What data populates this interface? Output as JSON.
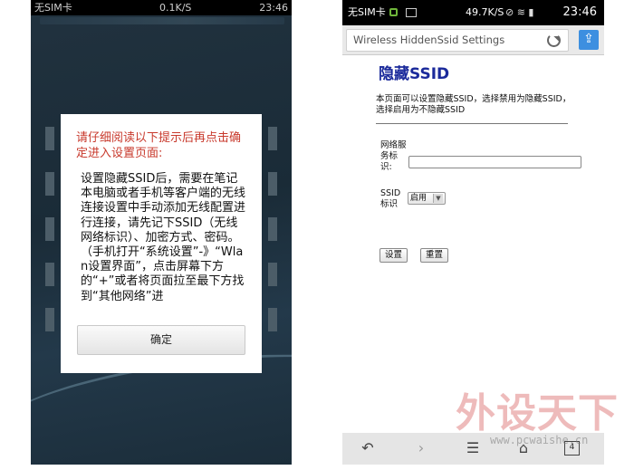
{
  "left_phone": {
    "status": {
      "carrier": "无SIM卡",
      "speed": "0.1K/S",
      "time": "23:46"
    },
    "dialog": {
      "heading": "请仔细阅读以下提示后再点击确定进入设置页面:",
      "body": "设置隐藏SSID后，需要在笔记本电脑或者手机等客户端的无线连接设置中手动添加无线配置进行连接，请先记下SSID（无线网络标识）、加密方式、密码。（手机打开“系统设置”-》“Wlan设置界面”，点击屏幕下方的“+”或者将页面拉至最下方找到“其他网络”进",
      "confirm_label": "确定"
    }
  },
  "right_phone": {
    "status": {
      "carrier": "无SIM卡",
      "speed": "49.7K/S",
      "time": "23:46"
    },
    "browser": {
      "url": "Wireless HiddenSsid Settings",
      "tab_count": "4"
    },
    "page": {
      "title": "隐藏SSID",
      "description": "本页面可以设置隐藏SSID，选择禁用为隐藏SSID，选择启用为不隐藏SSID",
      "ssid_label": "网络服务标识:",
      "ssid_value": "",
      "hide_label": "SSID标识",
      "hide_selected": "启用",
      "settings_button": "设置",
      "reset_button": "重置"
    }
  },
  "watermark": {
    "brand": "外设天下",
    "url": "www.pcwaishe.cn"
  },
  "colors": {
    "heading_red": "#c8392c",
    "title_blue": "#1b2a9b",
    "share_blue": "#3d8fe0"
  }
}
